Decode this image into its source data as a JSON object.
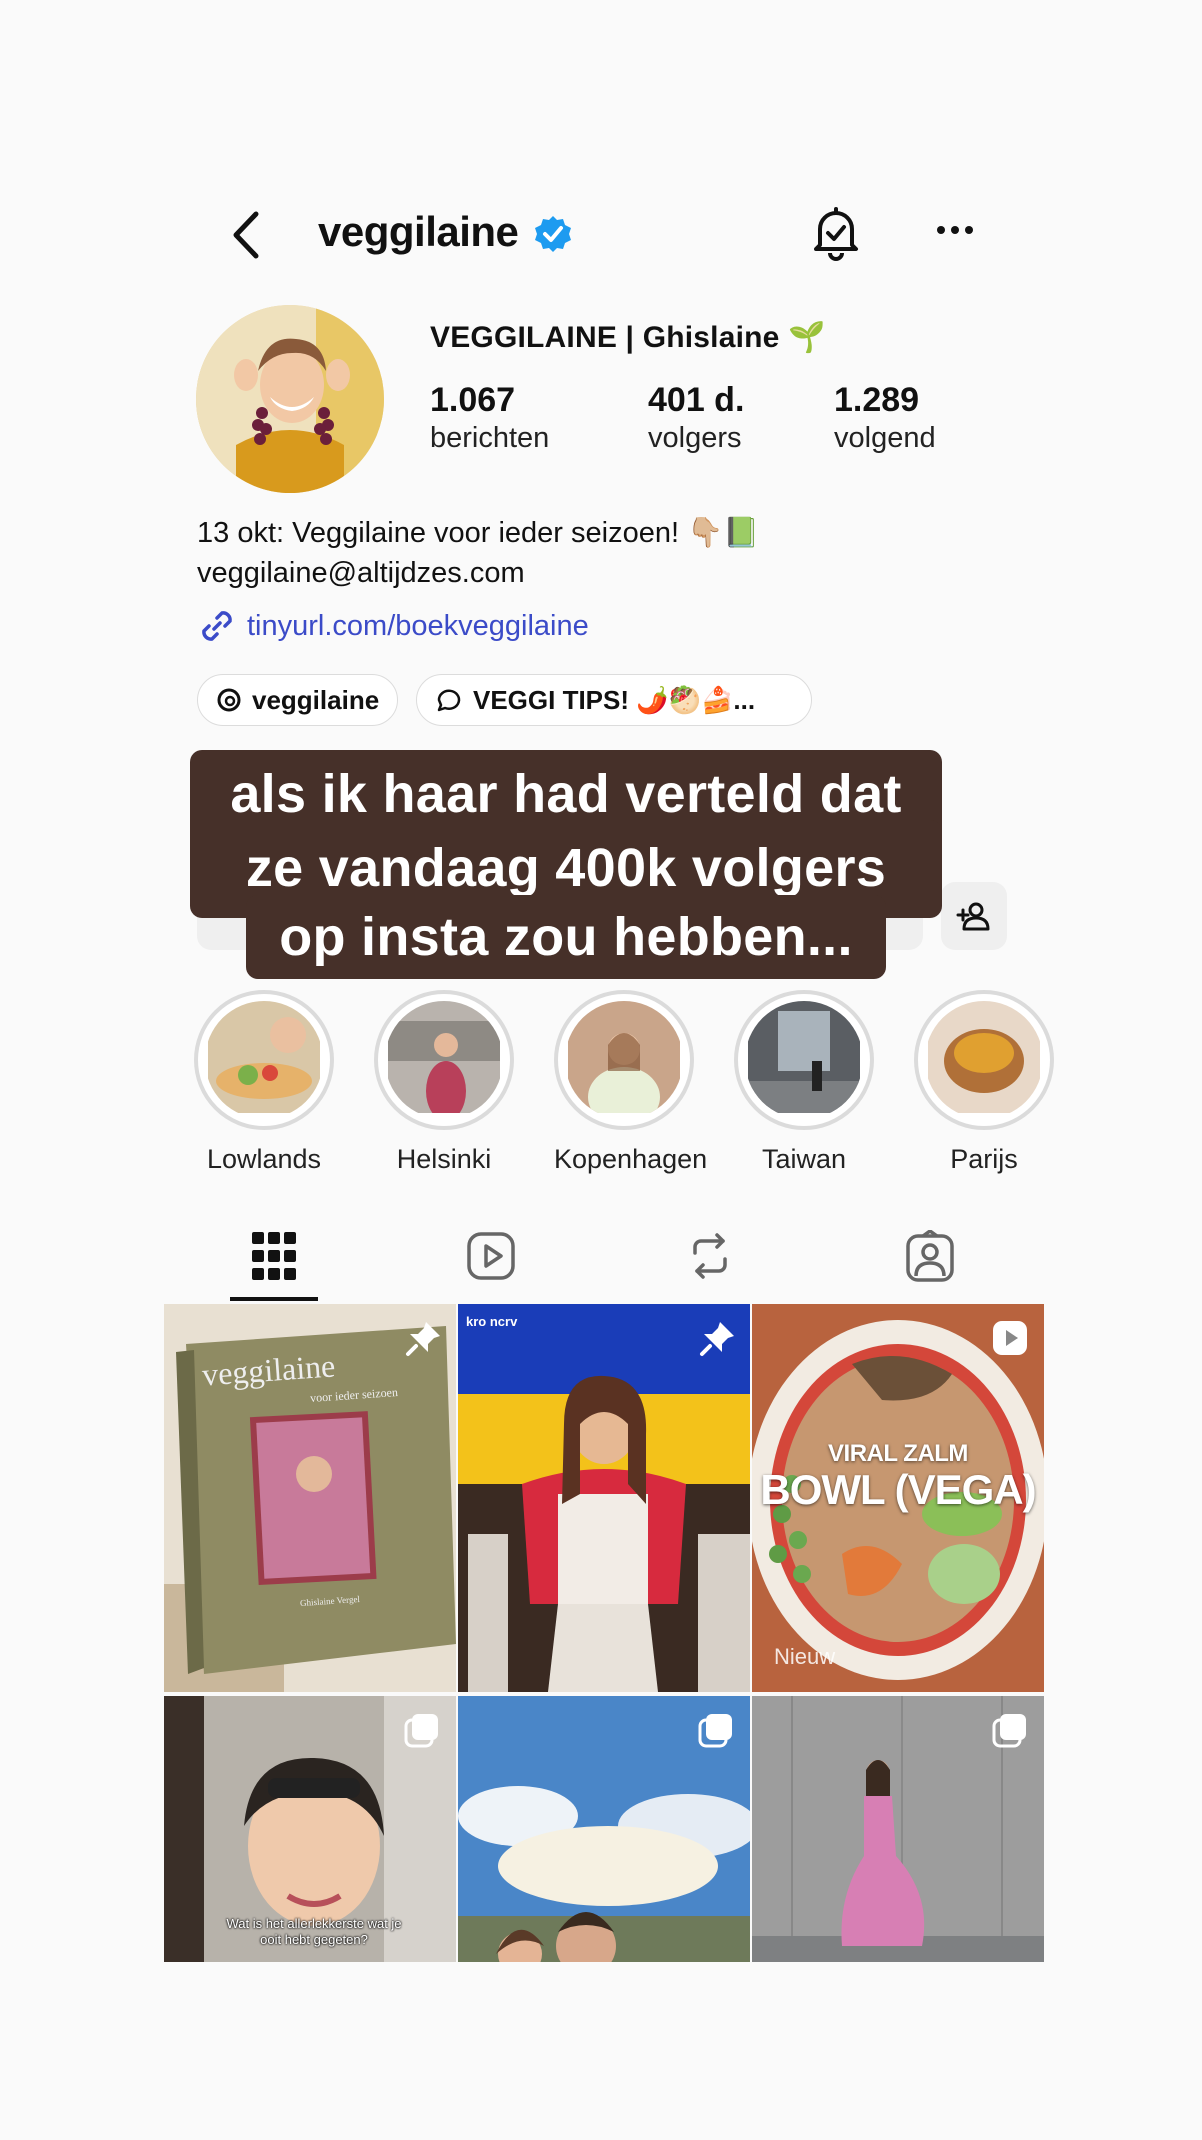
{
  "header": {
    "username": "veggilaine"
  },
  "profile": {
    "display_name": "VEGGILAINE | Ghislaine 🌱",
    "stats": [
      {
        "num": "1.067",
        "label": "berichten"
      },
      {
        "num": "401 d.",
        "label": "volgers"
      },
      {
        "num": "1.289",
        "label": "volgend"
      }
    ],
    "bio_line1": "13 okt: Veggilaine voor ieder seizoen! 👇🏼📗",
    "bio_line2": "veggilaine@altijdzes.com",
    "link": "tinyurl.com/boekveggilaine",
    "chips": [
      {
        "label": "veggilaine"
      },
      {
        "label": "VEGGI TIPS! 🌶️🥙🍰..."
      }
    ]
  },
  "caption": {
    "lines": [
      "als ik haar had verteld dat",
      "ze vandaag 400k volgers",
      "op insta zou hebben..."
    ]
  },
  "highlights": [
    {
      "label": "Lowlands"
    },
    {
      "label": "Helsinki"
    },
    {
      "label": "Kopenhagen"
    },
    {
      "label": "Taiwan"
    },
    {
      "label": "Parijs"
    }
  ],
  "grid": {
    "post1_title": "veggilaine",
    "post1_subtitle": "voor ieder seizoen",
    "post1_author": "Ghislaine Vergel",
    "post2_logo": "kro ncrv",
    "post3_title1": "VIRAL ZALM",
    "post3_title2": "BOWL (VEGA)",
    "post3_tag": "Nieuw",
    "post4_caption": "Wat is het allerlekkerste wat je ooit hebt gegeten?"
  },
  "colors": {
    "link": "#3b4bc8",
    "verified": "#1d9bf0",
    "caption_bg": "#463029"
  }
}
